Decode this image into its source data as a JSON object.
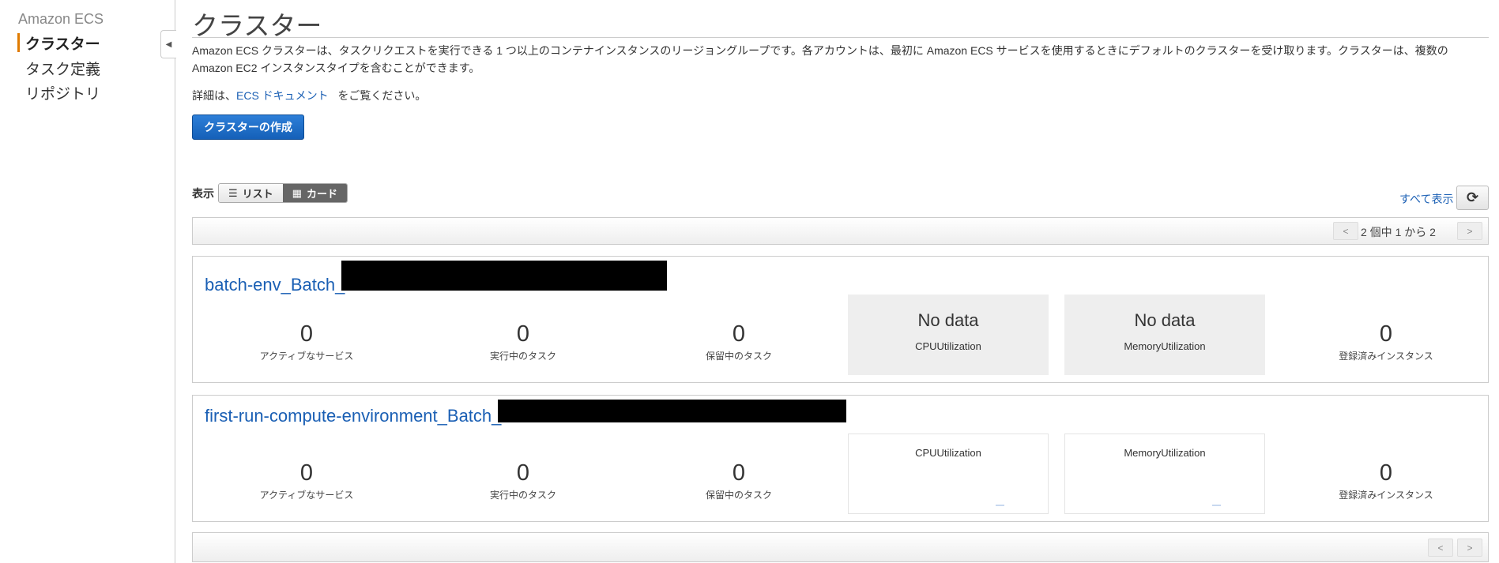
{
  "sidebar": {
    "header": "Amazon ECS",
    "items": [
      {
        "label": "クラスター",
        "active": true
      },
      {
        "label": "タスク定義"
      },
      {
        "label": "リポジトリ"
      }
    ]
  },
  "page": {
    "title": "クラスター",
    "description": "Amazon ECS クラスターは、タスクリクエストを実行できる 1 つ以上のコンテナインスタンスのリージョングループです。各アカウントは、最初に Amazon ECS サービスを使用するときにデフォルトのクラスターを受け取ります。クラスターは、複数の Amazon EC2 インスタンスタイプを含むことができます。",
    "more_prefix": "詳細は、",
    "more_link": "ECS ドキュメント",
    "more_suffix": "をご覧ください。",
    "create_button": "クラスターの作成",
    "view_label": "表示",
    "view_list": "リスト",
    "view_card": "カード",
    "show_all": "すべて表示",
    "pagination": "2 個中 1 から 2",
    "prev": "<",
    "next": ">"
  },
  "clusters": [
    {
      "name": "batch-env_Batch_",
      "active_services": "0",
      "active_services_label": "アクティブなサービス",
      "running_tasks": "0",
      "running_tasks_label": "実行中のタスク",
      "pending_tasks": "0",
      "pending_tasks_label": "保留中のタスク",
      "cpu_value": "No data",
      "cpu_label": "CPUUtilization",
      "mem_value": "No data",
      "mem_label": "MemoryUtilization",
      "instances": "0",
      "instances_label": "登録済みインスタンス"
    },
    {
      "name": "first-run-compute-environment_Batch_",
      "active_services": "0",
      "active_services_label": "アクティブなサービス",
      "running_tasks": "0",
      "running_tasks_label": "実行中のタスク",
      "pending_tasks": "0",
      "pending_tasks_label": "保留中のタスク",
      "cpu_label": "CPUUtilization",
      "mem_label": "MemoryUtilization",
      "instances": "0",
      "instances_label": "登録済みインスタンス"
    }
  ],
  "colors": {
    "accent": "#e07b00",
    "link": "#1a5fb4",
    "primary_button": "#1f6fc9"
  }
}
